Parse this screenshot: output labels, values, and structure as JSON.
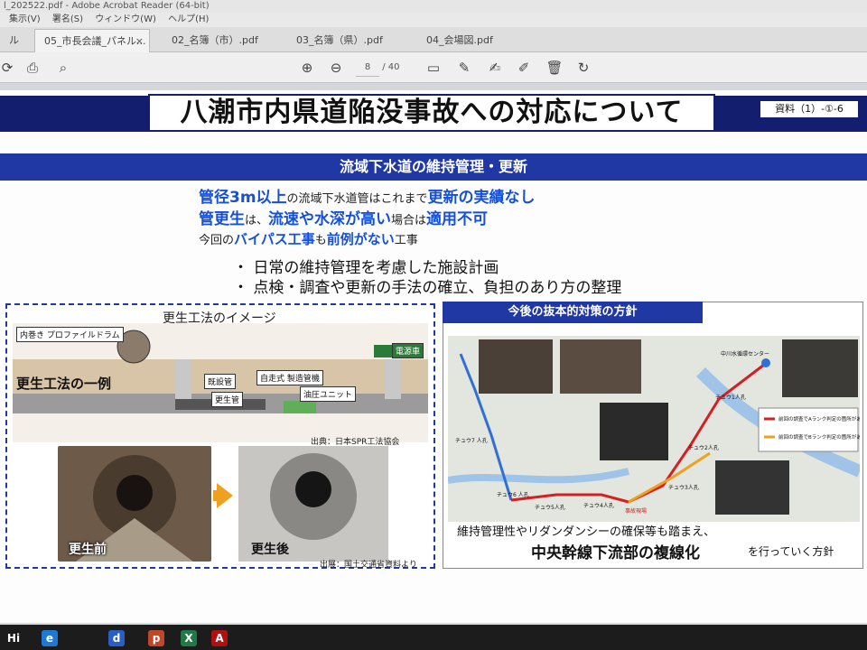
{
  "window": {
    "title": "l_202522.pdf - Adobe Acrobat Reader (64-bit)"
  },
  "menu": {
    "items": [
      "集示(V)",
      "署名(S)",
      "ウィンドウ(W)",
      "ヘルプ(H)"
    ]
  },
  "tabs": [
    {
      "label": "ル"
    },
    {
      "label": "05_市長会議_パネル..."
    },
    {
      "label": "02_名簿（市）.pdf"
    },
    {
      "label": "03_名簿（県）.pdf"
    },
    {
      "label": "04_会場図.pdf"
    }
  ],
  "toolbar": {
    "page_current": "8",
    "page_total": "/ 40"
  },
  "icons": {
    "up": "arrow-up-icon",
    "down": "arrow-down-icon",
    "comment": "comment-icon",
    "highlight": "pen-icon",
    "sign": "sign-icon",
    "edit": "edit-icon",
    "delete": "trash-icon",
    "rotate": "rotate-icon",
    "print": "print-icon",
    "zoom": "zoom-icon"
  },
  "slide": {
    "title": "八潮市内県道陥没事故への対応について",
    "ref": "資料（1）-①-6",
    "section": "流域下水道の維持管理・更新",
    "line1": {
      "a": "管径3m以上",
      "b": "の流域下水道管はこれまで",
      "c": "更新の実績なし"
    },
    "line2": {
      "a": "管更生",
      "b": "は、",
      "c": "流速や水深が高い",
      "d": "場合は",
      "e": "適用不可"
    },
    "line3": {
      "a": "今回の",
      "b": "バイパス工事",
      "c": "も",
      "d": "前例がない",
      "e": "工事"
    },
    "bullets": [
      "・ 日常の維持管理を考慮した施設計画",
      "・ 点検・調査や更新の手法の確立、負担のあり方の整理"
    ],
    "left": {
      "title": "更生工法のイメージ",
      "example": "更生工法の一例",
      "ann": [
        "内巻き プロファイルドラム",
        "既設管",
        "自走式 製造管機",
        "更生管",
        "油圧ユニット",
        "電源車"
      ],
      "source1": "出典：日本SPR工法協会",
      "before": "更生前",
      "after": "更生後",
      "source2": "出展：国土交通省資料より"
    },
    "right": {
      "title": "今後の抜本的対策の方針",
      "map_labels": [
        "中川水循環センター",
        "チュウ1人孔",
        "チュウ2人孔",
        "チュウ3人孔",
        "チュウ4人孔",
        "チュウ5人孔",
        "チュウ6 人孔",
        "チュウ7 人孔",
        "事故現場"
      ],
      "legend": [
        "前回の調査でAランク判定の箇所があった区間",
        "前回の調査でBランク判定の箇所があった区間"
      ],
      "text": "維持管理性やリダンダンシーの確保等も踏まえ、",
      "bold": "中央幹線下流部の複線化",
      "tail": "を行っていく方針"
    }
  },
  "taskbar": {
    "apps": [
      "Hi",
      "e",
      "d",
      "p",
      "X",
      "A"
    ]
  },
  "colors": {
    "navy": "#141e6e",
    "section": "#1f38a4",
    "accent": "#1550d9",
    "route_red": "#d42020",
    "route_orange": "#f0a020"
  }
}
